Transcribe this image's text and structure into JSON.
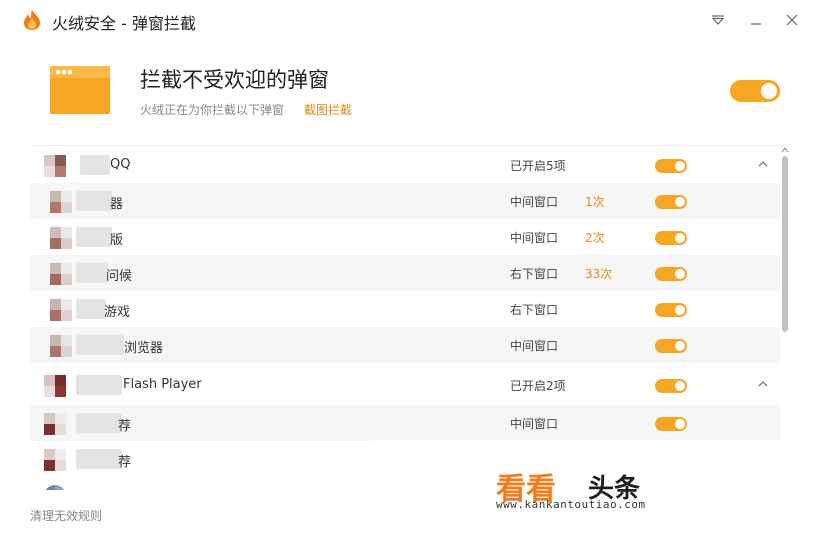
{
  "window": {
    "title": "火绒安全 - 弹窗拦截"
  },
  "header": {
    "title": "拦截不受欢迎的弹窗",
    "subtitle": "火绒正在为你拦截以下弹窗",
    "link": "截图拦截",
    "enabled": true
  },
  "groups": [
    {
      "name": "QQ",
      "status": "已开启5项",
      "enabled": true,
      "expanded": true,
      "items": [
        {
          "name": "器",
          "position": "中间窗口",
          "count": "1次",
          "enabled": true
        },
        {
          "name": "版",
          "position": "中间窗口",
          "count": "2次",
          "enabled": true
        },
        {
          "name": "问候",
          "position": "右下窗口",
          "count": "33次",
          "enabled": true
        },
        {
          "name": "游戏",
          "position": "右下窗口",
          "count": "",
          "enabled": true
        },
        {
          "name": "浏览器",
          "position": "中间窗口",
          "count": "",
          "enabled": true
        }
      ]
    },
    {
      "name": "Flash Player",
      "status": "已开启2项",
      "enabled": true,
      "expanded": true,
      "items": [
        {
          "name": "荐",
          "position": "中间窗口",
          "count": "",
          "enabled": true
        },
        {
          "name": "荐",
          "position": "",
          "count": "",
          "enabled": true
        }
      ]
    }
  ],
  "footer": {
    "clear_link": "清理无效规则"
  },
  "watermark": {
    "brand_orange": "看看",
    "brand_dark": "头条",
    "url": "www.kankantoutiao.com"
  },
  "colors": {
    "accent": "#f5a623",
    "link": "#e08a1e"
  }
}
